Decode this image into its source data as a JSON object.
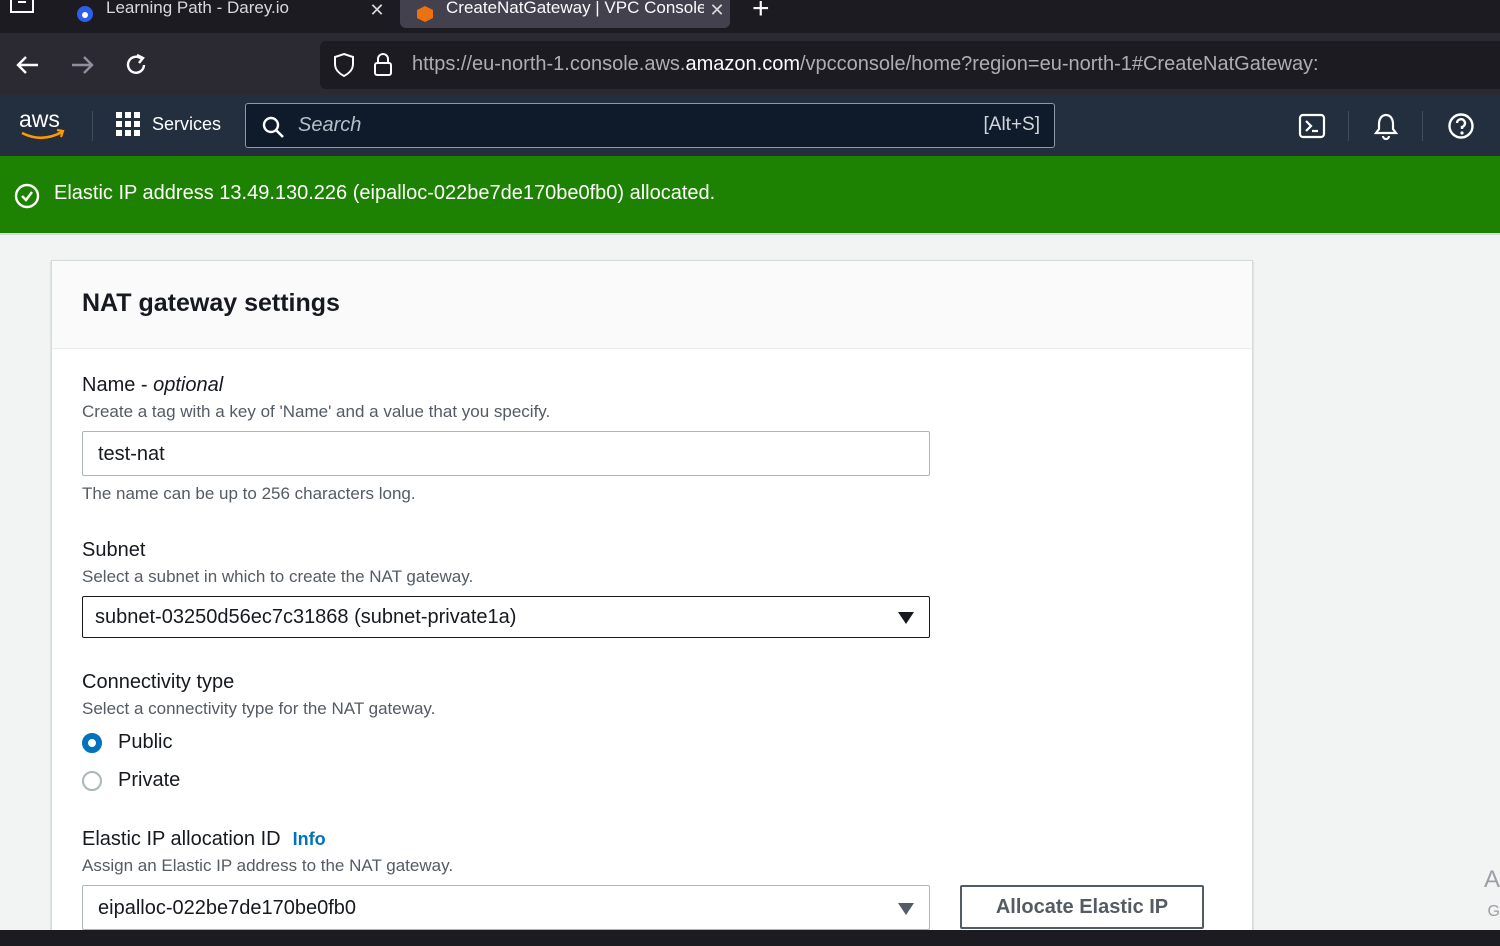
{
  "browser": {
    "tabs": [
      {
        "title": "Learning Path - Darey.io",
        "active": false
      },
      {
        "title": "CreateNatGateway | VPC Console",
        "active": true
      }
    ],
    "url_prefix": "https://eu-north-1.console.aws.",
    "url_host": "amazon.com",
    "url_suffix": "/vpcconsole/home?region=eu-north-1#CreateNatGateway:"
  },
  "aws_header": {
    "logo": "aws",
    "services_label": "Services",
    "search_placeholder": "Search",
    "search_shortcut": "[Alt+S]"
  },
  "flash": {
    "message": "Elastic IP address 13.49.130.226 (eipalloc-022be7de170be0fb0) allocated.",
    "color": "#1d8102"
  },
  "panel": {
    "title": "NAT gateway settings",
    "name_field": {
      "label": "Name - ",
      "label_optional": "optional",
      "description": "Create a tag with a key of 'Name' and a value that you specify.",
      "value": "test-nat",
      "constraint": "The name can be up to 256 characters long."
    },
    "subnet_field": {
      "label": "Subnet",
      "description": "Select a subnet in which to create the NAT gateway.",
      "value": "subnet-03250d56ec7c31868 (subnet-private1a)"
    },
    "connectivity": {
      "label": "Connectivity type",
      "description": "Select a connectivity type for the NAT gateway.",
      "options": [
        {
          "label": "Public",
          "selected": true
        },
        {
          "label": "Private",
          "selected": false
        }
      ]
    },
    "elastic_ip": {
      "label": "Elastic IP allocation ID",
      "info": "Info",
      "description": "Assign an Elastic IP address to the NAT gateway.",
      "value": "eipalloc-022be7de170be0fb0",
      "allocate_button": "Allocate Elastic IP"
    }
  },
  "colors": {
    "aws_header": "#232f3e",
    "accent": "#0073bb",
    "success": "#1d8102"
  }
}
